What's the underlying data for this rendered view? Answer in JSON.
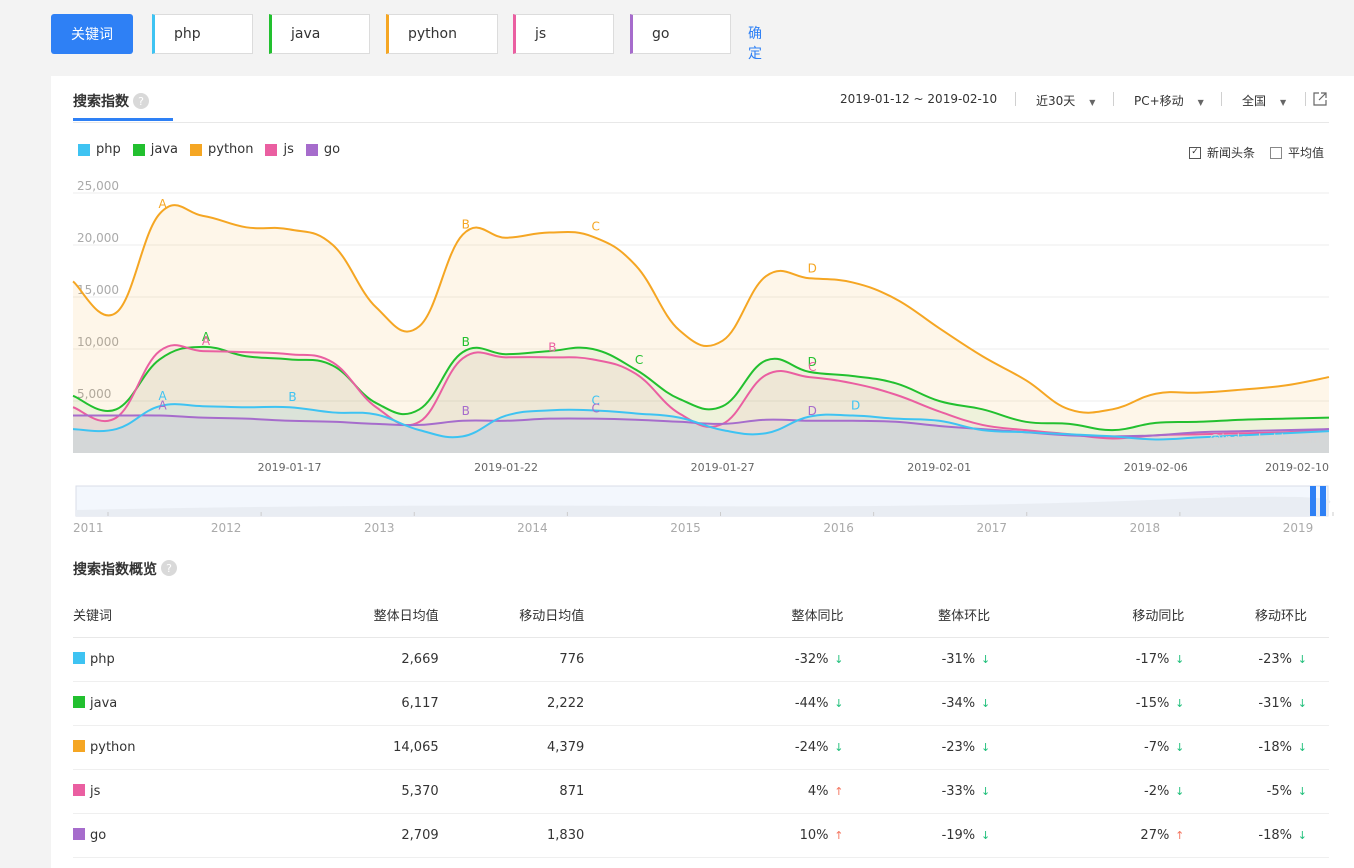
{
  "topbar": {
    "keyword_button": "关键词",
    "keywords": [
      {
        "label": "php",
        "color": "#3ec3f2"
      },
      {
        "label": "java",
        "color": "#22c02f"
      },
      {
        "label": "python",
        "color": "#f5a623"
      },
      {
        "label": "js",
        "color": "#ea5fa1"
      },
      {
        "label": "go",
        "color": "#a66ccc"
      }
    ],
    "confirm": "确定"
  },
  "panel": {
    "title": "搜索指数",
    "help": "?",
    "date_range": "2019-01-12 ~ 2019-02-10",
    "period": "近30天",
    "device": "PC+移动",
    "region": "全国",
    "open_icon": "external-link-icon",
    "news_checkbox": "新闻头条",
    "news_checked": true,
    "avg_checkbox": "平均值",
    "avg_checked": false
  },
  "chart_data": {
    "type": "line",
    "x": [
      "2019-01-12",
      "2019-01-13",
      "2019-01-14",
      "2019-01-15",
      "2019-01-16",
      "2019-01-17",
      "2019-01-18",
      "2019-01-19",
      "2019-01-20",
      "2019-01-21",
      "2019-01-22",
      "2019-01-23",
      "2019-01-24",
      "2019-01-25",
      "2019-01-26",
      "2019-01-27",
      "2019-01-28",
      "2019-01-29",
      "2019-01-30",
      "2019-01-31",
      "2019-02-01",
      "2019-02-02",
      "2019-02-03",
      "2019-02-04",
      "2019-02-05",
      "2019-02-06",
      "2019-02-07",
      "2019-02-08",
      "2019-02-09",
      "2019-02-10"
    ],
    "x_ticks": [
      "2019-01-17",
      "2019-01-22",
      "2019-01-27",
      "2019-02-01",
      "2019-02-06",
      "2019-02-10"
    ],
    "ylim": [
      0,
      25000
    ],
    "y_ticks": [
      "25,000",
      "20,000",
      "15,000",
      "10,000",
      "5,000"
    ],
    "series": [
      {
        "name": "php",
        "color": "#3ec3f2",
        "values": [
          2300,
          2300,
          4500,
          4500,
          4400,
          4400,
          3900,
          3700,
          2200,
          1600,
          3600,
          4100,
          4100,
          3800,
          3400,
          2200,
          1900,
          3500,
          3600,
          3300,
          3100,
          2200,
          2000,
          1800,
          1600,
          1300,
          1500,
          1700,
          1900,
          2100
        ]
      },
      {
        "name": "java",
        "color": "#22c02f",
        "values": [
          5500,
          4200,
          9000,
          10200,
          9300,
          9000,
          8400,
          4800,
          4200,
          9700,
          9500,
          9800,
          10000,
          8000,
          5200,
          4500,
          8900,
          7800,
          7400,
          6700,
          5000,
          4200,
          3000,
          2800,
          2200,
          2900,
          3000,
          3200,
          3300,
          3400
        ]
      },
      {
        "name": "python",
        "color": "#f5a623",
        "values": [
          16500,
          13500,
          23000,
          22800,
          21700,
          21500,
          20000,
          14000,
          12200,
          21000,
          20700,
          21200,
          20800,
          18000,
          11800,
          10800,
          17000,
          16800,
          16400,
          14800,
          12000,
          9300,
          7000,
          4200,
          4200,
          5700,
          5800,
          6100,
          6500,
          7300
        ]
      },
      {
        "name": "js",
        "color": "#ea5fa1",
        "values": [
          4400,
          3400,
          9800,
          9800,
          9700,
          9500,
          8700,
          4400,
          3000,
          9100,
          9200,
          9200,
          9000,
          7600,
          3800,
          2800,
          7500,
          7300,
          6700,
          5600,
          4000,
          2700,
          2200,
          1800,
          1400,
          1700,
          1800,
          1900,
          2000,
          2300
        ]
      },
      {
        "name": "go",
        "color": "#a66ccc",
        "values": [
          3600,
          3600,
          3600,
          3400,
          3300,
          3100,
          3000,
          2800,
          2700,
          3100,
          3100,
          3300,
          3300,
          3200,
          3000,
          2800,
          3200,
          3100,
          3100,
          3000,
          2600,
          2300,
          2000,
          1700,
          1600,
          1700,
          2000,
          2100,
          2200,
          2300
        ]
      }
    ],
    "annotations": [
      {
        "series": "python",
        "x": "2019-01-14",
        "label": "A"
      },
      {
        "series": "python",
        "x": "2019-01-21",
        "label": "B"
      },
      {
        "series": "python",
        "x": "2019-01-24",
        "label": "C"
      },
      {
        "series": "python",
        "x": "2019-01-29",
        "label": "D"
      },
      {
        "series": "java",
        "x": "2019-01-15",
        "label": "A"
      },
      {
        "series": "java",
        "x": "2019-01-21",
        "label": "B"
      },
      {
        "series": "java",
        "x": "2019-01-25",
        "label": "C"
      },
      {
        "series": "java",
        "x": "2019-01-29",
        "label": "D"
      },
      {
        "series": "js",
        "x": "2019-01-15",
        "label": "A"
      },
      {
        "series": "js",
        "x": "2019-01-23",
        "label": "B"
      },
      {
        "series": "js",
        "x": "2019-01-29",
        "label": "C"
      },
      {
        "series": "php",
        "x": "2019-01-14",
        "label": "A"
      },
      {
        "series": "php",
        "x": "2019-01-17",
        "label": "B"
      },
      {
        "series": "php",
        "x": "2019-01-24",
        "label": "C"
      },
      {
        "series": "php",
        "x": "2019-01-30",
        "label": "D"
      },
      {
        "series": "go",
        "x": "2019-01-14",
        "label": "A"
      },
      {
        "series": "go",
        "x": "2019-01-21",
        "label": "B"
      },
      {
        "series": "go",
        "x": "2019-01-24",
        "label": "C"
      },
      {
        "series": "go",
        "x": "2019-01-29",
        "label": "D"
      }
    ],
    "watermark": "@index.baidu.com",
    "slider_years": [
      "2011",
      "2012",
      "2013",
      "2014",
      "2015",
      "2016",
      "2017",
      "2018",
      "2019"
    ],
    "slider_range": [
      "2019-01-12",
      "2019-02-10"
    ]
  },
  "overview": {
    "title": "搜索指数概览",
    "help": "?",
    "headers": [
      "关键词",
      "整体日均值",
      "移动日均值",
      "整体同比",
      "整体环比",
      "移动同比",
      "移动环比"
    ],
    "rows": [
      {
        "name": "php",
        "color": "#3ec3f2",
        "cells": [
          "2,669",
          "776",
          "-32%",
          "-31%",
          "-17%",
          "-23%"
        ],
        "dirs": [
          "down",
          "down",
          "down",
          "down"
        ]
      },
      {
        "name": "java",
        "color": "#22c02f",
        "cells": [
          "6,117",
          "2,222",
          "-44%",
          "-34%",
          "-15%",
          "-31%"
        ],
        "dirs": [
          "down",
          "down",
          "down",
          "down"
        ]
      },
      {
        "name": "python",
        "color": "#f5a623",
        "cells": [
          "14,065",
          "4,379",
          "-24%",
          "-23%",
          "-7%",
          "-18%"
        ],
        "dirs": [
          "down",
          "down",
          "down",
          "down"
        ]
      },
      {
        "name": "js",
        "color": "#ea5fa1",
        "cells": [
          "5,370",
          "871",
          "4%",
          "-33%",
          "-2%",
          "-5%"
        ],
        "dirs": [
          "up",
          "down",
          "down",
          "down"
        ]
      },
      {
        "name": "go",
        "color": "#a66ccc",
        "cells": [
          "2,709",
          "1,830",
          "10%",
          "-19%",
          "27%",
          "-18%"
        ],
        "dirs": [
          "up",
          "down",
          "up",
          "down"
        ]
      }
    ]
  }
}
